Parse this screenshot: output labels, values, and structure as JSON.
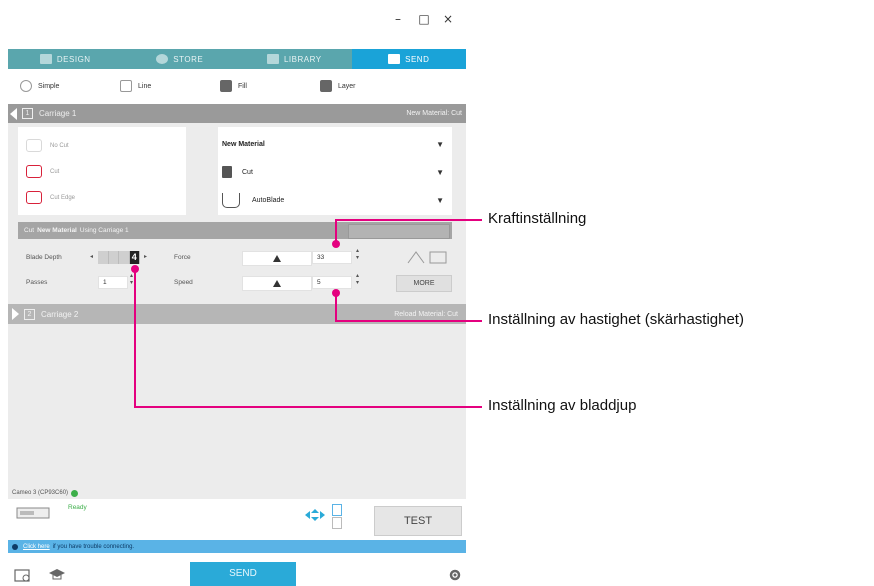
{
  "window": {
    "controls": [
      "–",
      "□",
      "×"
    ]
  },
  "tabs": [
    {
      "label": "DESIGN",
      "icon": "design-icon",
      "active": false
    },
    {
      "label": "STORE",
      "icon": "store-icon",
      "active": false
    },
    {
      "label": "LIBRARY",
      "icon": "library-icon",
      "active": false
    },
    {
      "label": "SEND",
      "icon": "send-icon",
      "active": true
    }
  ],
  "modes": [
    {
      "label": "Simple",
      "selected": true
    },
    {
      "label": "Line",
      "selected": false
    },
    {
      "label": "Fill",
      "selected": false
    },
    {
      "label": "Layer",
      "selected": false
    }
  ],
  "cartridge1": {
    "number": "1",
    "label": "Carriage 1",
    "right": "New Material: Cut"
  },
  "tools": [
    {
      "label": "No Cut",
      "active": false
    },
    {
      "label": "Cut",
      "active": true
    },
    {
      "label": "Cut Edge",
      "active": true
    }
  ],
  "material": {
    "name": "New Material",
    "action": "Cut",
    "tool": "AutoBlade",
    "dropdown_glyph": "▼"
  },
  "cutbar": {
    "prefix": "Cut",
    "material": "New Material",
    "suffix": "Using Carriage 1"
  },
  "settings": {
    "blade_depth_label": "Blade Depth",
    "blade_depth_value": "4",
    "force_label": "Force",
    "force_value": "33",
    "passes_label": "Passes",
    "passes_value": "1",
    "speed_label": "Speed",
    "speed_value": "5",
    "more_label": "MORE"
  },
  "cartridge2": {
    "number": "2",
    "label": "Carriage 2",
    "right": "Reload Material: Cut"
  },
  "device": {
    "label": "Cameo 3 (CP93C60)"
  },
  "status": {
    "label": "Ready"
  },
  "test_label": "TEST",
  "info": {
    "link": "Click here",
    "text": "if you have trouble connecting."
  },
  "send_label": "SEND",
  "callouts": {
    "force": "Kraftinställning",
    "speed": "Inställning av hastighet (skärhastighet)",
    "blade_depth": "Inställning av bladdjup"
  },
  "colors": {
    "accent": "#1aa3d8",
    "tab_bar": "#5aa6ad",
    "callout": "#e4007f",
    "tool_red": "#d8213a"
  }
}
